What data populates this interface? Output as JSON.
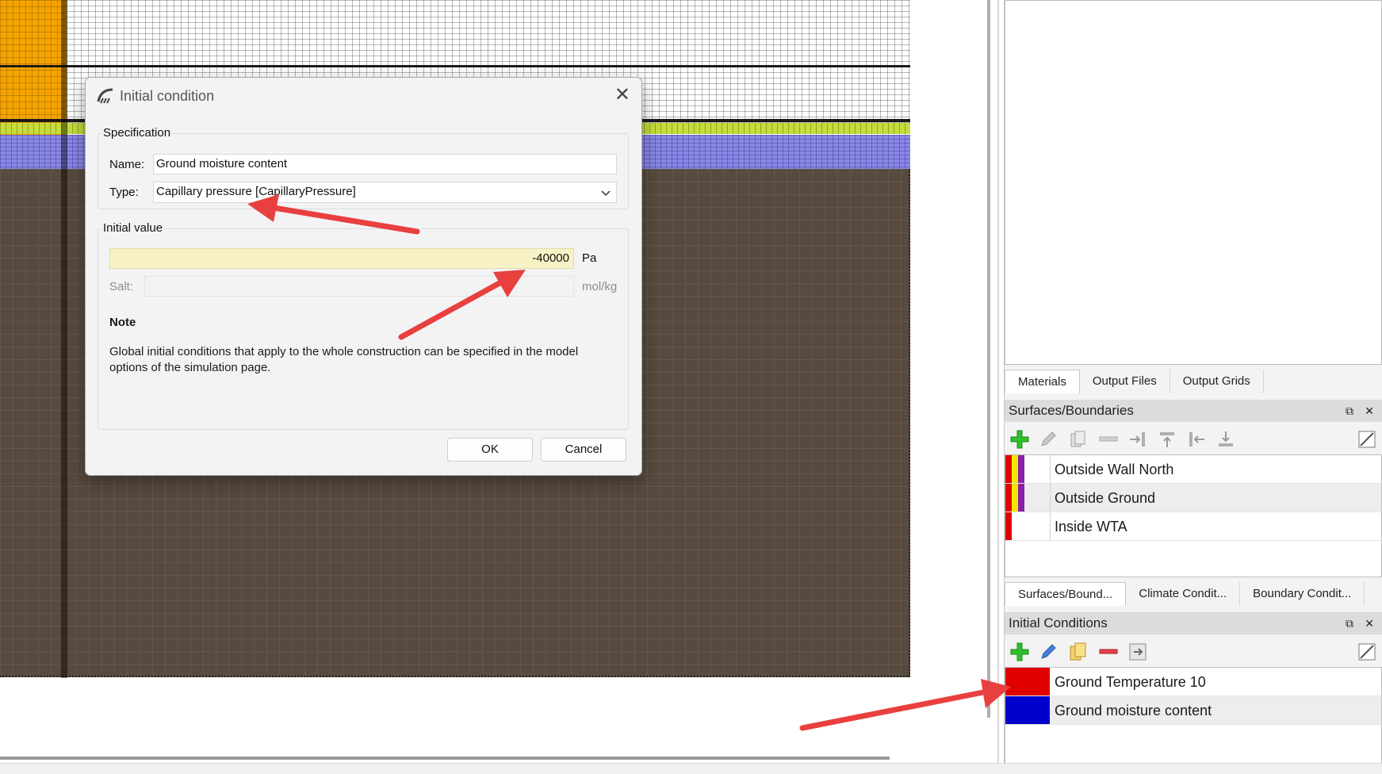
{
  "dialog": {
    "title": "Initial condition",
    "specification_group": "Specification",
    "name_label": "Name:",
    "name_value": "Ground moisture content",
    "type_label": "Type:",
    "type_value": "Capillary pressure [CapillaryPressure]",
    "initial_value_group": "Initial value",
    "value": "-40000",
    "value_unit": "Pa",
    "salt_label": "Salt:",
    "salt_value": "",
    "salt_unit": "mol/kg",
    "note_title": "Note",
    "note_text": "Global initial conditions that apply to the whole construction can be specified in the model options of the simulation page.",
    "ok_label": "OK",
    "cancel_label": "Cancel"
  },
  "top_tabs": [
    "Materials",
    "Output Files",
    "Output Grids"
  ],
  "surfaces_panel": {
    "title": "Surfaces/Boundaries",
    "items": [
      {
        "label": "Outside Wall North",
        "colors": [
          "#e00000",
          "#f4e600",
          "#8a1fa8"
        ]
      },
      {
        "label": "Outside Ground",
        "colors": [
          "#e00000",
          "#f4e600",
          "#8a1fa8"
        ]
      },
      {
        "label": "Inside WTA",
        "colors": [
          "#e00000"
        ]
      }
    ]
  },
  "bottom_tabs": [
    "Surfaces/Bound...",
    "Climate Condit...",
    "Boundary Condit..."
  ],
  "initial_conditions_panel": {
    "title": "Initial Conditions",
    "items": [
      {
        "label": "Ground Temperature 10",
        "color": "#e00000"
      },
      {
        "label": "Ground moisture content",
        "color": "#0000cc"
      }
    ]
  },
  "icons": {
    "dialog": "app-logo-icon",
    "close": "close-icon",
    "combo": "chevron-down-icon",
    "toolbar": [
      "add-icon",
      "edit-icon",
      "copy-icon",
      "remove-icon",
      "assign-icon",
      "filter-icon"
    ]
  },
  "colors": {
    "arrow": "#e8403f",
    "input_highlight": "#f8f3c6",
    "ground": "#574a3e",
    "panel_title": "#dcdcdc"
  }
}
